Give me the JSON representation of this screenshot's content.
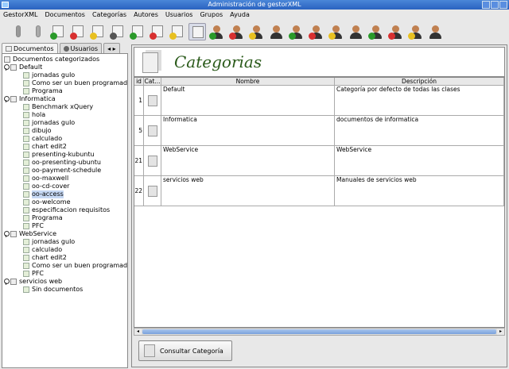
{
  "window": {
    "title": "Administración de gestorXML"
  },
  "menu": [
    "GestorXML",
    "Documentos",
    "Categorías",
    "Autores",
    "Usuarios",
    "Grupos",
    "Ayuda"
  ],
  "toolbar": [
    {
      "icon": "disconnect-icon",
      "kind": "plain",
      "color": "#999999"
    },
    {
      "icon": "plug-icon",
      "kind": "plain",
      "color": "#aaaaaa"
    },
    {
      "icon": "add-category-icon",
      "kind": "doc",
      "badge": "#2a9a2a"
    },
    {
      "icon": "delete-category-icon",
      "kind": "doc",
      "badge": "#d83030"
    },
    {
      "icon": "edit-category-icon",
      "kind": "doc",
      "badge": "#e8c020"
    },
    {
      "icon": "search-category-icon",
      "kind": "doc",
      "badge": "#555555"
    },
    {
      "icon": "add-document-icon",
      "kind": "doc",
      "badge": "#2a9a2a"
    },
    {
      "icon": "delete-document-icon",
      "kind": "doc",
      "badge": "#d83030"
    },
    {
      "icon": "edit-document-icon",
      "kind": "doc",
      "badge": "#e8c020"
    },
    {
      "icon": "view-document-icon",
      "kind": "doc",
      "badge": "",
      "selected": true
    },
    {
      "icon": "add-author-icon",
      "kind": "person",
      "badge": "#2a9a2a"
    },
    {
      "icon": "delete-author-icon",
      "kind": "person",
      "badge": "#d83030"
    },
    {
      "icon": "edit-author-icon",
      "kind": "person",
      "badge": "#e8c020"
    },
    {
      "icon": "view-author-icon",
      "kind": "person",
      "badge": ""
    },
    {
      "icon": "add-user-icon",
      "kind": "person",
      "badge": "#2a9a2a"
    },
    {
      "icon": "delete-user-icon",
      "kind": "person",
      "badge": "#d83030"
    },
    {
      "icon": "edit-user-icon",
      "kind": "person",
      "badge": "#e8c020"
    },
    {
      "icon": "view-user-icon",
      "kind": "person",
      "badge": ""
    },
    {
      "icon": "add-group-icon",
      "kind": "person",
      "badge": "#2a9a2a"
    },
    {
      "icon": "delete-group-icon",
      "kind": "person",
      "badge": "#d83030"
    },
    {
      "icon": "edit-group-icon",
      "kind": "person",
      "badge": "#e8c020"
    },
    {
      "icon": "view-group-icon",
      "kind": "person",
      "badge": ""
    }
  ],
  "left_tabs": [
    "Documentos",
    "Usuarios"
  ],
  "tree": {
    "root": "Documentos categorizados",
    "categories": [
      {
        "name": "Default",
        "docs": [
          "jornadas gulo",
          "Como ser un buen programador",
          "Programa"
        ]
      },
      {
        "name": "Informatica",
        "docs": [
          "Benchmark xQuery",
          "hola",
          "jornadas gulo",
          "dibujo",
          "calculado",
          "chart edit2",
          "presenting-kubuntu",
          "oo-presenting-ubuntu",
          "oo-payment-schedule",
          "oo-maxwell",
          "oo-cd-cover",
          "oo-access",
          "oo-welcome",
          "especificacion requisitos",
          "Programa",
          "PFC"
        ]
      },
      {
        "name": "WebService",
        "docs": [
          "jornadas gulo",
          "calculado",
          "chart edit2",
          "Como ser un buen programador",
          "PFC"
        ]
      },
      {
        "name": "servicios web",
        "docs": [
          "Sin documentos"
        ]
      }
    ],
    "selected": "oo-access"
  },
  "main": {
    "title": "Categorias",
    "columns": [
      "id",
      "Cat...",
      "Nombre",
      "Descripción"
    ],
    "rows": [
      {
        "id": "1",
        "nombre": "Default",
        "descripcion": "Categoría por defecto de todas las clases"
      },
      {
        "id": "5",
        "nombre": "Informatica",
        "descripcion": "documentos de informatica"
      },
      {
        "id": "21",
        "nombre": "WebService",
        "descripcion": "WebService"
      },
      {
        "id": "22",
        "nombre": "servicios web",
        "descripcion": "Manuales de servicios web"
      }
    ],
    "button": "Consultar Categoría"
  }
}
